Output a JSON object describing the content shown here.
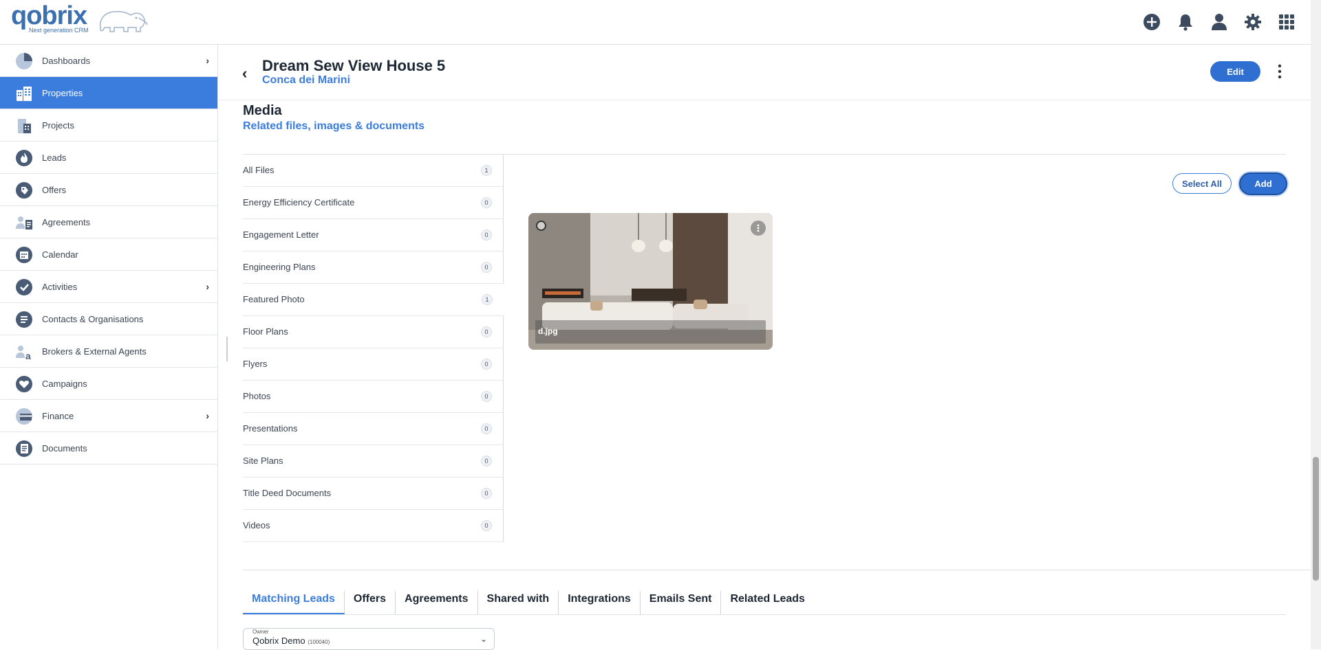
{
  "app": {
    "logo_text": "qobrix",
    "logo_tagline": "Next generation CRM",
    "brand_color": "#3b7ddd"
  },
  "header_icons": [
    {
      "icon": "add-circle-icon"
    },
    {
      "icon": "bell-icon"
    },
    {
      "icon": "user-icon"
    },
    {
      "icon": "gear-icon"
    },
    {
      "icon": "apps-grid-icon"
    }
  ],
  "sidebar": {
    "items": [
      {
        "label": "Dashboards",
        "icon": "pie-chart-icon",
        "has_submenu": true
      },
      {
        "label": "Properties",
        "icon": "buildings-icon",
        "active": true
      },
      {
        "label": "Projects",
        "icon": "project-building-icon"
      },
      {
        "label": "Leads",
        "icon": "flame-icon"
      },
      {
        "label": "Offers",
        "icon": "tag-icon"
      },
      {
        "label": "Agreements",
        "icon": "agreement-icon"
      },
      {
        "label": "Calendar",
        "icon": "calendar-icon"
      },
      {
        "label": "Activities",
        "icon": "check-circle-icon",
        "has_submenu": true
      },
      {
        "label": "Contacts & Organisations",
        "icon": "contacts-icon"
      },
      {
        "label": "Brokers & External Agents",
        "icon": "broker-icon"
      },
      {
        "label": "Campaigns",
        "icon": "heart-icon"
      },
      {
        "label": "Finance",
        "icon": "finance-icon",
        "has_submenu": true
      },
      {
        "label": "Documents",
        "icon": "documents-icon"
      }
    ]
  },
  "page": {
    "title": "Dream Sew View House 5",
    "subtitle": "Conca dei Marini",
    "edit_label": "Edit"
  },
  "media": {
    "title": "Media",
    "subtitle": "Related files, images & documents",
    "select_all_label": "Select All",
    "add_label": "Add",
    "categories": [
      {
        "label": "All Files",
        "count": "1"
      },
      {
        "label": "Energy Efficiency Certificate",
        "count": "0"
      },
      {
        "label": "Engagement Letter",
        "count": "0"
      },
      {
        "label": "Engineering Plans",
        "count": "0"
      },
      {
        "label": "Featured Photo",
        "count": "1",
        "selected": true
      },
      {
        "label": "Floor Plans",
        "count": "0"
      },
      {
        "label": "Flyers",
        "count": "0"
      },
      {
        "label": "Photos",
        "count": "0"
      },
      {
        "label": "Presentations",
        "count": "0"
      },
      {
        "label": "Site Plans",
        "count": "0"
      },
      {
        "label": "Title Deed Documents",
        "count": "0"
      },
      {
        "label": "Videos",
        "count": "0"
      }
    ],
    "files": [
      {
        "name": "d.jpg"
      }
    ]
  },
  "tabs": [
    {
      "label": "Matching Leads",
      "active": true
    },
    {
      "label": "Offers"
    },
    {
      "label": "Agreements"
    },
    {
      "label": "Shared with"
    },
    {
      "label": "Integrations"
    },
    {
      "label": "Emails Sent"
    },
    {
      "label": "Related Leads"
    }
  ],
  "owner": {
    "label": "Owner",
    "value": "Qobrix Demo",
    "id": "(100040)"
  }
}
